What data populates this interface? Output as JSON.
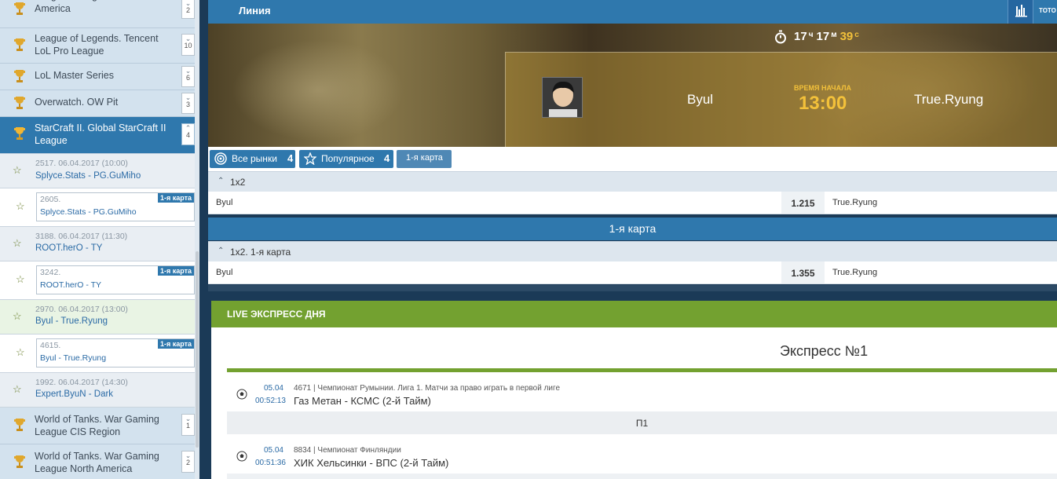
{
  "sidebar": {
    "leagues_top": [
      {
        "name": "League of Legends. LCS North America",
        "count": "2"
      },
      {
        "name": "League of Legends. Tencent LoL Pro League",
        "count": "10"
      },
      {
        "name": "LoL Master Series",
        "count": "6"
      },
      {
        "name": "Overwatch. OW Pit",
        "count": "3"
      }
    ],
    "active_league": {
      "name": "StarCraft II. Global StarCraft II League",
      "count": "4"
    },
    "matches": [
      {
        "id": "2517. 06.04.2017 (10:00)",
        "teams": "Splyce.Stats - PG.GuMiho",
        "sub": {
          "id": "2605.",
          "teams": "Splyce.Stats - PG.GuMiho",
          "badge": "1-я карта"
        }
      },
      {
        "id": "3188. 06.04.2017 (11:30)",
        "teams": "ROOT.herO - TY",
        "sub": {
          "id": "3242.",
          "teams": "ROOT.herO - TY",
          "badge": "1-я карта"
        }
      },
      {
        "id": "2970. 06.04.2017 (13:00)",
        "teams": "Byul - True.Ryung",
        "sub": {
          "id": "4615.",
          "teams": "Byul - True.Ryung",
          "badge": "1-я карта"
        }
      },
      {
        "id": "1992. 06.04.2017 (14:30)",
        "teams": "Expert.ByuN - Dark"
      }
    ],
    "leagues_bottom": [
      {
        "name": "World of Tanks. War Gaming League CIS Region",
        "count": "1"
      },
      {
        "name": "World of Tanks. War Gaming League North America",
        "count": "2"
      }
    ]
  },
  "header": {
    "title": "Линия",
    "toto_label": "ТОТО"
  },
  "banner": {
    "timer": {
      "hours": "17",
      "hours_unit": "ч",
      "minutes": "17",
      "minutes_unit": "м",
      "seconds": "39",
      "seconds_unit": "с"
    },
    "team1": "Byul",
    "team2": "True.Ryung",
    "start_label": "ВРЕМЯ НАЧАЛА",
    "start_time": "13:00"
  },
  "tabs": [
    {
      "label": "Все рынки",
      "count": "4",
      "icon": "target-icon"
    },
    {
      "label": "Популярное",
      "count": "4",
      "icon": "star-icon"
    },
    {
      "label": "1-я карта"
    }
  ],
  "markets": [
    {
      "title": "1x2",
      "team1": "Byul",
      "odds": "1.215",
      "team2": "True.Ryung"
    },
    {
      "title": "1x2. 1-я карта",
      "team1": "Byul",
      "odds": "1.355",
      "team2": "True.Ryung"
    }
  ],
  "map_section_title": "1-я карта",
  "express": {
    "header": "LIVE ЭКСПРЕСС ДНЯ",
    "title": "Экспресс №1",
    "events": [
      {
        "date": "05.04",
        "time": "00:52:13",
        "info": "4671 | Чемпионат Румынии. Лига 1. Матчи за право играть в первой лиге",
        "name": "Газ Метан - КСМС (2-й Тайм)",
        "pick": "П1"
      },
      {
        "date": "05.04",
        "time": "00:51:36",
        "info": "8834 | Чемпионат Финляндии",
        "name": "ХИК Хельсинки - ВПС (2-й Тайм)"
      }
    ]
  }
}
